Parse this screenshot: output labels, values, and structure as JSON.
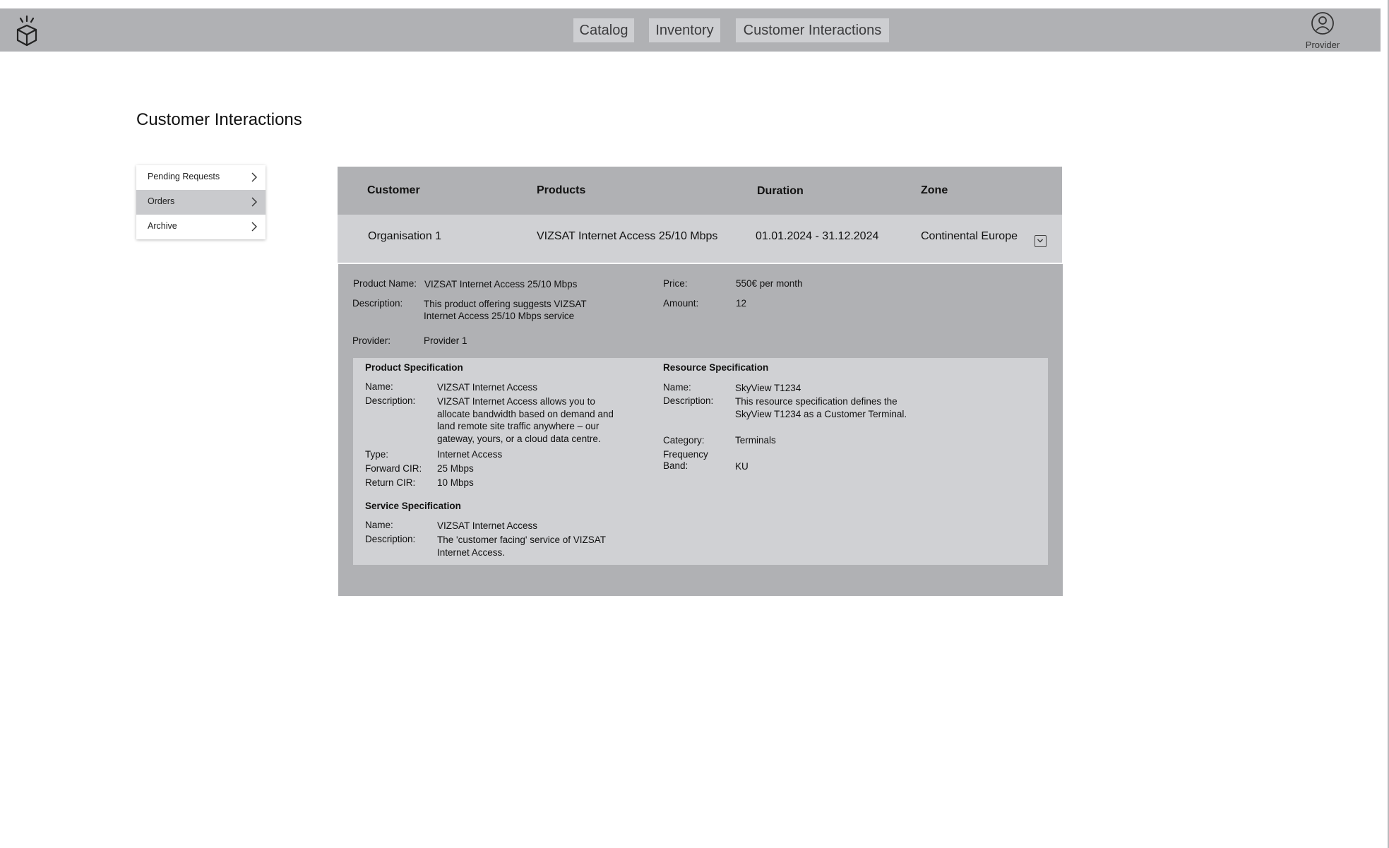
{
  "topbar": {
    "logo_icon": "cube-icon",
    "tabs": [
      {
        "label": "Catalog"
      },
      {
        "label": "Inventory"
      },
      {
        "label": "Customer Interactions"
      }
    ],
    "user": {
      "icon": "user-icon",
      "label": "Provider"
    }
  },
  "page": {
    "title": "Customer Interactions"
  },
  "sidebar": {
    "items": [
      {
        "label": "Pending Requests",
        "active": false
      },
      {
        "label": "Orders",
        "active": true
      },
      {
        "label": "Archive",
        "active": false
      }
    ]
  },
  "table": {
    "headers": {
      "customer": "Customer",
      "products": "Products",
      "duration": "Duration",
      "zone": "Zone"
    },
    "row": {
      "customer": "Organisation 1",
      "products": "VIZSAT Internet Access 25/10 Mbps",
      "duration": "01.01.2024 - 31.12.2024",
      "zone": "Continental Europe"
    }
  },
  "details": {
    "product_name_label": "Product Name:",
    "product_name": "VIZSAT Internet Access 25/10 Mbps",
    "description_label": "Description:",
    "description_line1": "This product offering suggests VIZSAT",
    "description_line2": "Internet Access 25/10 Mbps service",
    "provider_label": "Provider:",
    "provider": "Provider 1",
    "price_label": "Price:",
    "price": "550€ per month",
    "amount_label": "Amount:",
    "amount": "12"
  },
  "product_spec": {
    "title": "Product Specification",
    "name_label": "Name:",
    "name": "VIZSAT Internet Access",
    "description_label": "Description:",
    "description_lines": [
      "VIZSAT Internet Access allows you to",
      "allocate bandwidth based on demand and",
      "land remote site traffic anywhere – our",
      "gateway, yours, or a cloud data centre."
    ],
    "type_label": "Type:",
    "type": "Internet Access",
    "forward_cir_label": "Forward CIR:",
    "forward_cir": "25 Mbps",
    "return_cir_label": "Return CIR:",
    "return_cir": "10 Mbps"
  },
  "service_spec": {
    "title": "Service Specification",
    "name_label": "Name:",
    "name": "VIZSAT Internet Access",
    "description_label": "Description:",
    "description_lines": [
      "The 'customer facing' service of VIZSAT",
      "Internet Access."
    ]
  },
  "resource_spec": {
    "title": "Resource Specification",
    "name_label": "Name:",
    "name": "SkyView T1234",
    "description_label": "Description:",
    "description_lines": [
      "This resource specification defines the",
      "SkyView T1234 as a Customer Terminal."
    ],
    "category_label": "Category:",
    "category": "Terminals",
    "frequency_band_label_line1": "Frequency",
    "frequency_band_label_line2": "Band:",
    "frequency_band": "KU"
  }
}
